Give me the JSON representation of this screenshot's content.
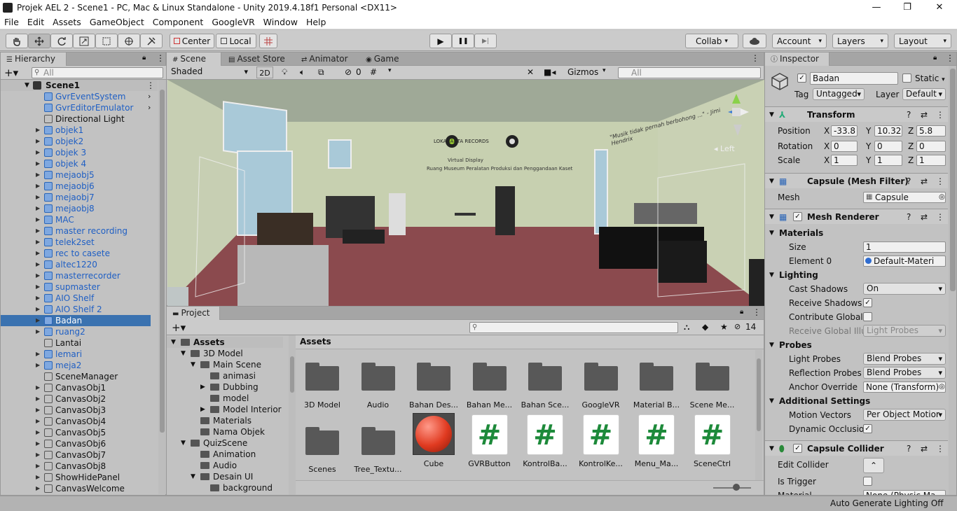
{
  "window": {
    "title": "Projek AEL 2 - Scene1 - PC, Mac & Linux Standalone - Unity 2019.4.18f1 Personal <DX11>",
    "minimize": "—",
    "maximize": "❐",
    "close": "✕"
  },
  "menu": [
    "File",
    "Edit",
    "Assets",
    "GameObject",
    "Component",
    "GoogleVR",
    "Window",
    "Help"
  ],
  "toolbar": {
    "center": "Center",
    "local": "Local",
    "collab": "Collab",
    "account": "Account",
    "layers": "Layers",
    "layout": "Layout",
    "play": "▶",
    "pause": "❚❚",
    "step": "▶|"
  },
  "hierarchy": {
    "tab": "Hierarchy",
    "search_placeholder": "All",
    "scene": "Scene1",
    "items": [
      {
        "name": "GvrEventSystem",
        "blue": true,
        "arrow": false,
        "right": true
      },
      {
        "name": "GvrEditorEmulator",
        "blue": true,
        "arrow": false,
        "right": true
      },
      {
        "name": "Directional Light",
        "blue": false,
        "arrow": false
      },
      {
        "name": "objek1",
        "blue": true,
        "arrow": true
      },
      {
        "name": "objek2",
        "blue": true,
        "arrow": true
      },
      {
        "name": "objek 3",
        "blue": true,
        "arrow": true
      },
      {
        "name": "objek 4",
        "blue": true,
        "arrow": true
      },
      {
        "name": "mejaobj5",
        "blue": true,
        "arrow": true
      },
      {
        "name": "mejaobj6",
        "blue": true,
        "arrow": true
      },
      {
        "name": "mejaobj7",
        "blue": true,
        "arrow": true
      },
      {
        "name": "mejaobj8",
        "blue": true,
        "arrow": true
      },
      {
        "name": "MAC",
        "blue": true,
        "arrow": true
      },
      {
        "name": "master recording",
        "blue": true,
        "arrow": true
      },
      {
        "name": "telek2set",
        "blue": true,
        "arrow": true
      },
      {
        "name": "rec to casete",
        "blue": true,
        "arrow": true
      },
      {
        "name": "altec1220",
        "blue": true,
        "arrow": true
      },
      {
        "name": "masterrecorder",
        "blue": true,
        "arrow": true
      },
      {
        "name": "supmaster",
        "blue": true,
        "arrow": true
      },
      {
        "name": "AIO Shelf",
        "blue": true,
        "arrow": true
      },
      {
        "name": "AIO Shelf 2",
        "blue": true,
        "arrow": true
      },
      {
        "name": "Badan",
        "blue": true,
        "arrow": true,
        "selected": true
      },
      {
        "name": "ruang2",
        "blue": true,
        "arrow": true
      },
      {
        "name": "Lantai",
        "blue": false,
        "arrow": false
      },
      {
        "name": "lemari",
        "blue": true,
        "arrow": true
      },
      {
        "name": "meja2",
        "blue": true,
        "arrow": true
      },
      {
        "name": "SceneManager",
        "blue": false,
        "arrow": false
      },
      {
        "name": "CanvasObj1",
        "blue": false,
        "arrow": true
      },
      {
        "name": "CanvasObj2",
        "blue": false,
        "arrow": true
      },
      {
        "name": "CanvasObj3",
        "blue": false,
        "arrow": true
      },
      {
        "name": "CanvasObj4",
        "blue": false,
        "arrow": true
      },
      {
        "name": "CanvasObj5",
        "blue": false,
        "arrow": true
      },
      {
        "name": "CanvasObj6",
        "blue": false,
        "arrow": true
      },
      {
        "name": "CanvasObj7",
        "blue": false,
        "arrow": true
      },
      {
        "name": "CanvasObj8",
        "blue": false,
        "arrow": true
      },
      {
        "name": "ShowHidePanel",
        "blue": false,
        "arrow": true
      },
      {
        "name": "CanvasWelcome",
        "blue": false,
        "arrow": true
      }
    ]
  },
  "scene": {
    "tabs": [
      "Scene",
      "Asset Store",
      "Animator",
      "Game"
    ],
    "shading": "Shaded",
    "mode2d": "2D",
    "hidden_count": "0",
    "gizmos": "Gizmos",
    "search_placeholder": "All",
    "view_label": "Left",
    "wall_text": "\"Musik tidak pernah berbohong ...\" - Jimi Hendrix",
    "logo_text": "LOKANANTA RECORDS",
    "sign_line1": "Virtual Display",
    "sign_line2": "Ruang Museum Peralatan Produksi dan Penggandaan Kaset"
  },
  "project": {
    "tab": "Project",
    "hidden_count": "14",
    "root": "Assets",
    "tree": [
      {
        "name": "Assets",
        "level": 0,
        "open": true,
        "bold": true
      },
      {
        "name": "3D Model",
        "level": 1,
        "open": true
      },
      {
        "name": "Main Scene",
        "level": 2,
        "open": true
      },
      {
        "name": "animasi",
        "level": 3
      },
      {
        "name": "Dubbing",
        "level": 3,
        "closed": true
      },
      {
        "name": "model",
        "level": 3
      },
      {
        "name": "Model Interior",
        "level": 3,
        "closed": true
      },
      {
        "name": "Materials",
        "level": 2
      },
      {
        "name": "Nama Objek",
        "level": 2
      },
      {
        "name": "QuizScene",
        "level": 1,
        "open": true
      },
      {
        "name": "Animation",
        "level": 2
      },
      {
        "name": "Audio",
        "level": 2
      },
      {
        "name": "Desain UI",
        "level": 2,
        "open": true
      },
      {
        "name": "background",
        "level": 3
      }
    ],
    "breadcrumb": "Assets",
    "assets": [
      {
        "name": "3D Model",
        "type": "folder"
      },
      {
        "name": "Audio",
        "type": "folder"
      },
      {
        "name": "Bahan Des...",
        "type": "folder"
      },
      {
        "name": "Bahan Me...",
        "type": "folder"
      },
      {
        "name": "Bahan Sce...",
        "type": "folder"
      },
      {
        "name": "GoogleVR",
        "type": "folder"
      },
      {
        "name": "Material B...",
        "type": "folder"
      },
      {
        "name": "Scene Me...",
        "type": "folder"
      },
      {
        "name": "Scenes",
        "type": "folder"
      },
      {
        "name": "Tree_Textu...",
        "type": "folder"
      },
      {
        "name": "Cube",
        "type": "material"
      },
      {
        "name": "GVRButton",
        "type": "script"
      },
      {
        "name": "KontrolBa...",
        "type": "script"
      },
      {
        "name": "KontrolKe...",
        "type": "script"
      },
      {
        "name": "Menu_Ma...",
        "type": "script"
      },
      {
        "name": "SceneCtrl",
        "type": "script"
      }
    ],
    "script_glyph": "#"
  },
  "inspector": {
    "tab": "Inspector",
    "object_name": "Badan",
    "static": "Static",
    "tag_label": "Tag",
    "tag": "Untagged",
    "layer_label": "Layer",
    "layer": "Default",
    "transform": {
      "title": "Transform",
      "position": "Position",
      "rotation": "Rotation",
      "scale": "Scale",
      "px": "-33.8",
      "py": "10.32",
      "pz": "5.8",
      "rx": "0",
      "ry": "0",
      "rz": "0",
      "sx": "1",
      "sy": "1",
      "sz": "1",
      "x": "X",
      "y": "Y",
      "z": "Z"
    },
    "meshfilter": {
      "title": "Capsule (Mesh Filter)",
      "mesh_label": "Mesh",
      "mesh": "Capsule"
    },
    "meshrenderer": {
      "title": "Mesh Renderer",
      "materials": "Materials",
      "size_label": "Size",
      "size": "1",
      "element0_label": "Element 0",
      "element0": "Default-Materi",
      "lighting": "Lighting",
      "cast_shadows_label": "Cast Shadows",
      "cast_shadows": "On",
      "receive_shadows": "Receive Shadows",
      "contribute_gi": "Contribute Global I",
      "receive_gi": "Receive Global Illu",
      "receive_gi_val": "Light Probes",
      "probes": "Probes",
      "light_probes_label": "Light Probes",
      "light_probes": "Blend Probes",
      "reflection_label": "Reflection Probes",
      "reflection": "Blend Probes",
      "anchor_label": "Anchor Override",
      "anchor": "None (Transform)",
      "additional": "Additional Settings",
      "motion_label": "Motion Vectors",
      "motion": "Per Object Motior",
      "dyn_occ": "Dynamic Occlusio"
    },
    "collider": {
      "title": "Capsule Collider",
      "edit_label": "Edit Collider",
      "trigger_label": "Is Trigger",
      "material_label": "Material",
      "material": "None (Physic Ma"
    }
  },
  "status": {
    "right": "Auto Generate Lighting Off"
  },
  "colors": {
    "selection": "#3a72b0",
    "blue_text": "#1f5fc4",
    "floor": "#8b4a4e",
    "wall": "#c9d3b4"
  }
}
